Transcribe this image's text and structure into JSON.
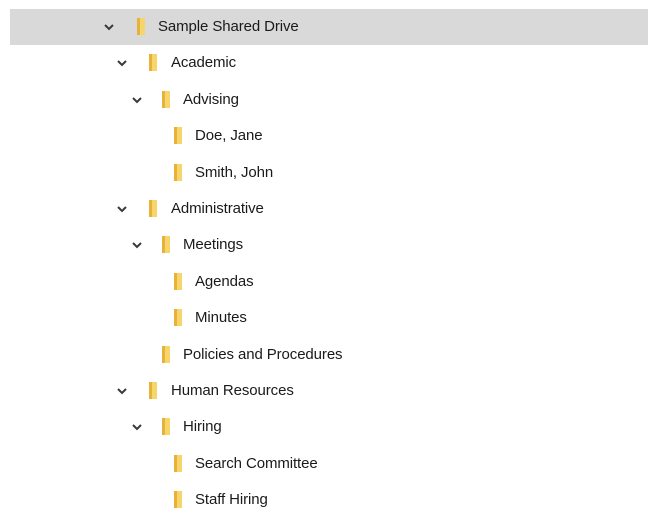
{
  "colors": {
    "selected_row": "#d9d9d9",
    "folder_light": "#f6d56b",
    "folder_dark": "#e8b13a",
    "chevron": "#3a3a3a",
    "text": "#1a1a1a"
  },
  "icons": {
    "expander": "chevron-down-icon",
    "folder": "folder-icon"
  },
  "tree": {
    "items": [
      {
        "label": "Sample Shared Drive",
        "level": 0,
        "expanded": true,
        "selected": true
      },
      {
        "label": "Academic",
        "level": 1,
        "expanded": true
      },
      {
        "label": "Advising",
        "level": 2,
        "expanded": true
      },
      {
        "label": "Doe, Jane",
        "level": 3
      },
      {
        "label": "Smith, John",
        "level": 3
      },
      {
        "label": "Administrative",
        "level": 1,
        "expanded": true
      },
      {
        "label": "Meetings",
        "level": 2,
        "expanded": true
      },
      {
        "label": "Agendas",
        "level": 3
      },
      {
        "label": "Minutes",
        "level": 3
      },
      {
        "label": "Policies and Procedures",
        "level": 2
      },
      {
        "label": "Human Resources",
        "level": 1,
        "expanded": true
      },
      {
        "label": "Hiring",
        "level": 2,
        "expanded": true
      },
      {
        "label": "Search Committee",
        "level": 3
      },
      {
        "label": "Staff Hiring",
        "level": 3
      }
    ]
  }
}
